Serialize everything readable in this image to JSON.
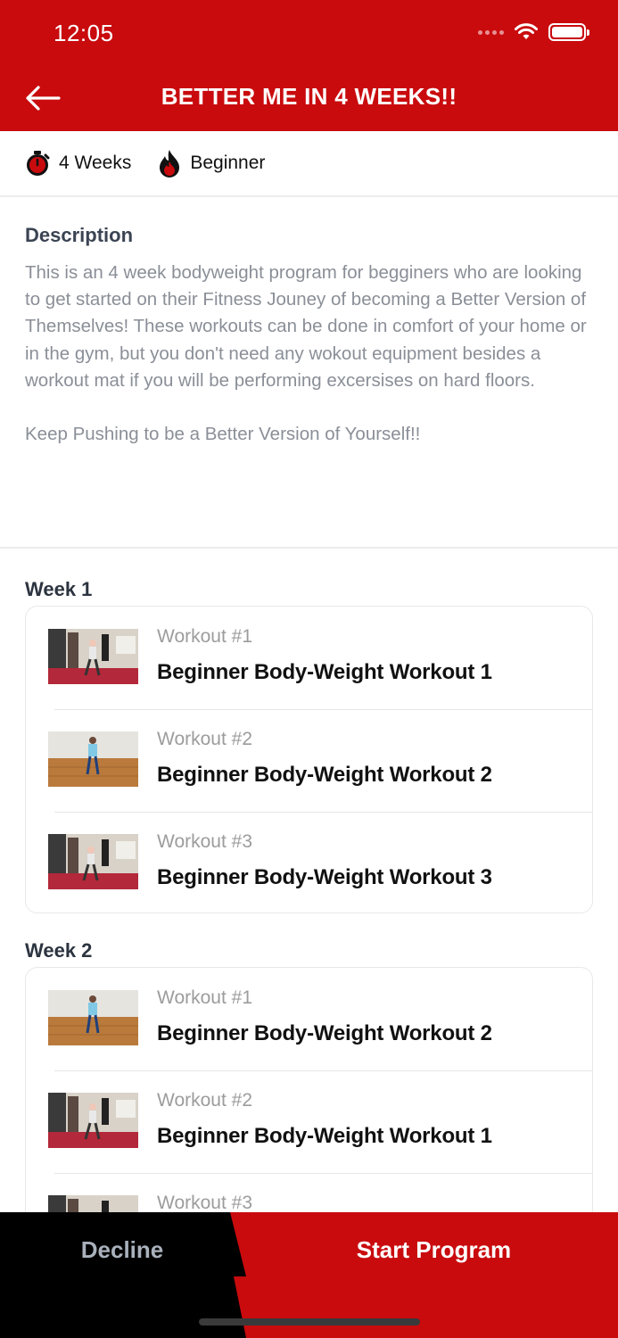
{
  "status_bar": {
    "time": "12:05"
  },
  "header": {
    "title": "BETTER ME IN 4 WEEKS!!",
    "back_icon": "arrow-left-icon"
  },
  "meta": {
    "duration": {
      "icon": "stopwatch-icon",
      "label": "4 Weeks"
    },
    "level": {
      "icon": "flame-icon",
      "label": "Beginner"
    }
  },
  "description": {
    "heading": "Description",
    "paragraph1": "This is an 4 week bodyweight program for begginers who are looking to get started on their Fitness Jouney of becoming a Better Version of Themselves! These workouts can be done in comfort of your home or in the gym, but you don't need any wokout equipment besides a workout mat if you will be performing excersises on hard floors.",
    "paragraph2": "Keep Pushing to be a Better Version of Yourself!!"
  },
  "weeks": [
    {
      "label": "Week 1",
      "workouts": [
        {
          "number": "Workout #1",
          "name": "Beginner Body-Weight Workout 1",
          "thumbnail": "gym-room"
        },
        {
          "number": "Workout #2",
          "name": "Beginner Body-Weight Workout 2",
          "thumbnail": "wood-floor"
        },
        {
          "number": "Workout #3",
          "name": "Beginner Body-Weight Workout 3",
          "thumbnail": "gym-room"
        }
      ]
    },
    {
      "label": "Week 2",
      "workouts": [
        {
          "number": "Workout #1",
          "name": "Beginner Body-Weight Workout 2",
          "thumbnail": "wood-floor"
        },
        {
          "number": "Workout #2",
          "name": "Beginner Body-Weight Workout 1",
          "thumbnail": "gym-room"
        },
        {
          "number": "Workout #3",
          "name": "",
          "thumbnail": "gym-room"
        }
      ]
    }
  ],
  "actions": {
    "decline": "Decline",
    "start": "Start Program"
  },
  "colors": {
    "brand_red": "#c90b0e",
    "black": "#000000",
    "muted_text": "#8a8f97"
  }
}
